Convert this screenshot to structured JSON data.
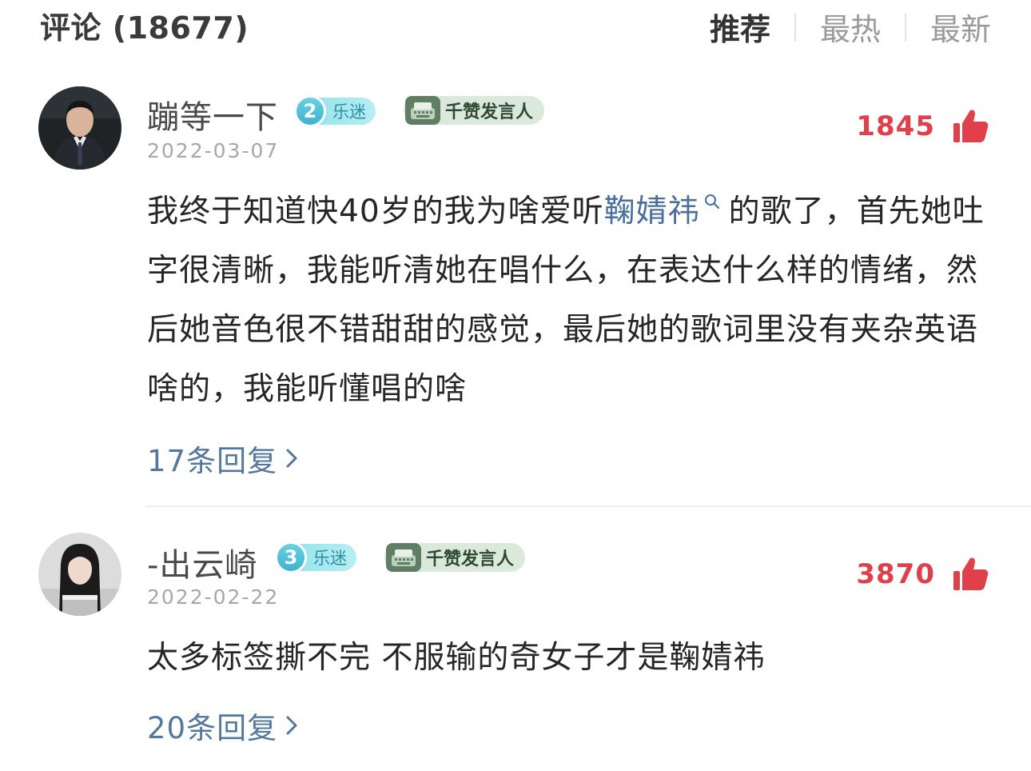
{
  "header": {
    "title": "评论 (18677)",
    "tabs": [
      {
        "label": "推荐",
        "active": true
      },
      {
        "label": "最热",
        "active": false
      },
      {
        "label": "最新",
        "active": false
      }
    ]
  },
  "comments": [
    {
      "username": "蹦等一下",
      "level_num": "2",
      "level_label": "乐迷",
      "honor_label": "千赞发言人",
      "date": "2022-03-07",
      "likes": "1845",
      "content_before": "我终于知道快40岁的我为啥爱听",
      "mention": "鞠婧祎",
      "content_after": "的歌了，首先她吐字很清晰，我能听清她在唱什么，在表达什么样的情绪，然后她音色很不错甜甜的感觉，最后她的歌词里没有夹杂英语啥的，我能听懂唱的啥",
      "replies": "17条回复"
    },
    {
      "username": "-出云崎",
      "level_num": "3",
      "level_label": "乐迷",
      "honor_label": "千赞发言人",
      "date": "2022-02-22",
      "likes": "3870",
      "content": "太多标签撕不完 不服输的奇女子才是鞠婧祎",
      "replies": "20条回复"
    }
  ],
  "colors": {
    "like_red": "#e0404a",
    "link_blue": "#54779c",
    "mention_blue": "#4a6f9a"
  }
}
